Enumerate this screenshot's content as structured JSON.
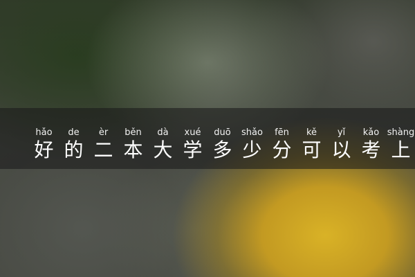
{
  "title": {
    "chars": [
      {
        "hanzi": "好",
        "pinyin": "hǎo"
      },
      {
        "hanzi": "的",
        "pinyin": "de"
      },
      {
        "hanzi": "二",
        "pinyin": "èr"
      },
      {
        "hanzi": "本",
        "pinyin": "běn"
      },
      {
        "hanzi": "大",
        "pinyin": "dà"
      },
      {
        "hanzi": "学",
        "pinyin": "xué"
      },
      {
        "hanzi": "多",
        "pinyin": "duō"
      },
      {
        "hanzi": "少",
        "pinyin": "shǎo"
      },
      {
        "hanzi": "分",
        "pinyin": "fēn"
      },
      {
        "hanzi": "可",
        "pinyin": "kě"
      },
      {
        "hanzi": "以",
        "pinyin": "yǐ"
      },
      {
        "hanzi": "考",
        "pinyin": "kǎo"
      },
      {
        "hanzi": "上",
        "pinyin": "shàng"
      }
    ]
  },
  "colors": {
    "text": "#ffffff",
    "band": "#191919",
    "accent_yellow": "#d9b226"
  }
}
